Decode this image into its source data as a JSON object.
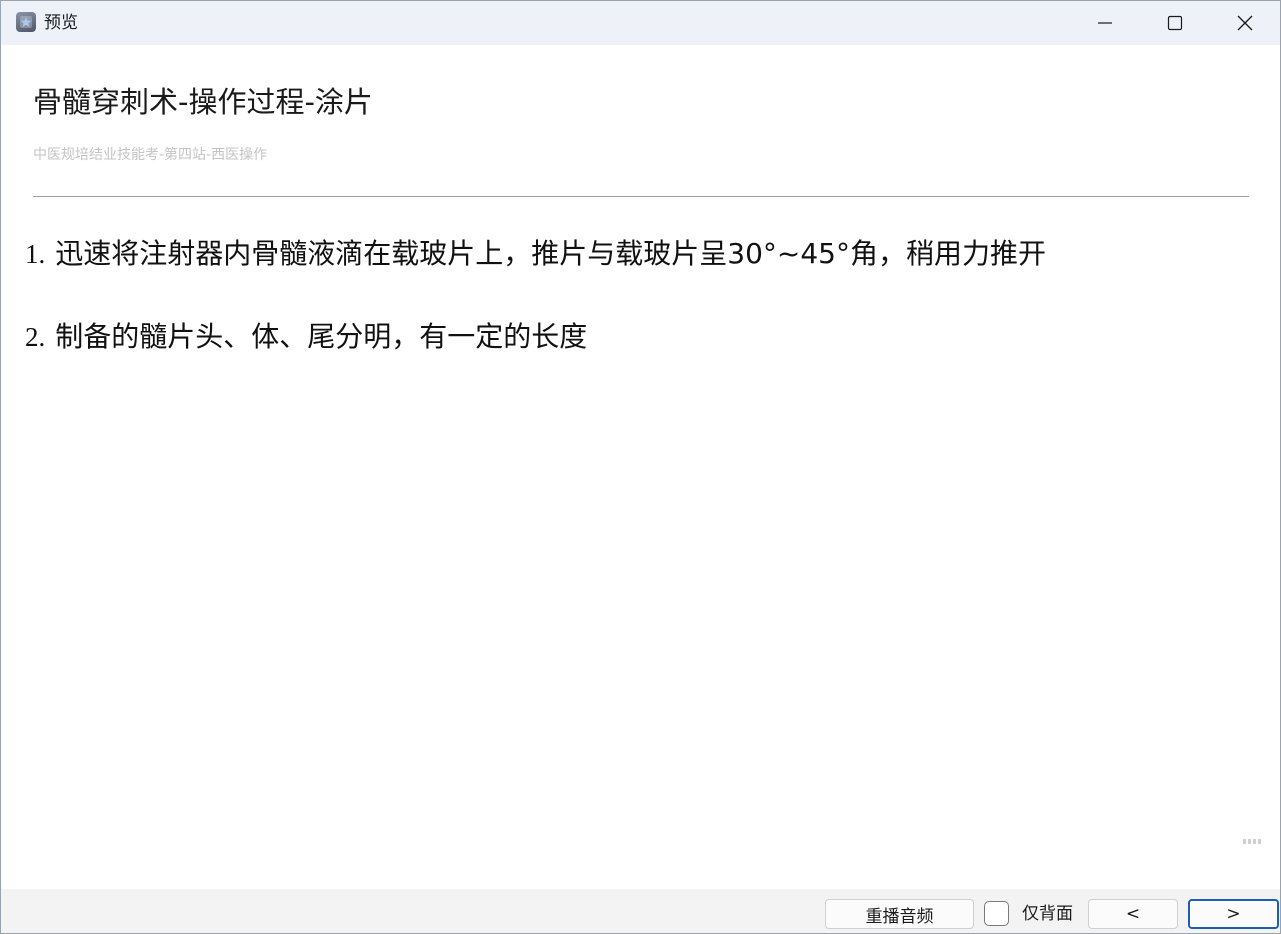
{
  "window": {
    "title": "预览"
  },
  "document": {
    "title": "骨髓穿刺术-操作过程-涂片",
    "subtitle": "中医规培结业技能考-第四站-西医操作",
    "steps": [
      {
        "number": "1.",
        "text": "迅速将注射器内骨髓液滴在载玻片上，推片与载玻片呈30°~45°角，稍用力推开"
      },
      {
        "number": "2.",
        "text": "制备的髓片头、体、尾分明，有一定的长度"
      }
    ]
  },
  "controls": {
    "replay_label": "重播音频",
    "back_only_label": "仅背面",
    "back_only_checked": false,
    "prev_label": "<",
    "next_label": ">"
  },
  "colors": {
    "titlebar_bg": "#eef2f8",
    "focus_border": "#1a5fb4",
    "subtitle_text": "#c4c4c4"
  },
  "icons": {
    "app": "app-icon",
    "minimize": "minimize-icon",
    "maximize": "maximize-icon",
    "close": "close-icon",
    "resize_grip": "resize-grip-icon"
  }
}
